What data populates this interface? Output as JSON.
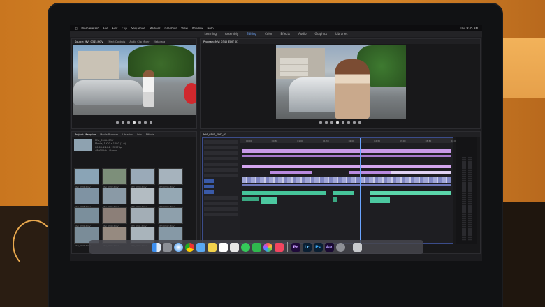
{
  "menubar": {
    "items": [
      "Premiere Pro",
      "File",
      "Edit",
      "Clip",
      "Sequence",
      "Markers",
      "Graphics",
      "View",
      "Window",
      "Help"
    ],
    "status": "Thu 9:45 AM"
  },
  "workspace": {
    "tabs": [
      "Learning",
      "Assembly",
      "Editing",
      "Color",
      "Effects",
      "Audio",
      "Graphics",
      "Libraries",
      "Editing"
    ],
    "active_index": 2
  },
  "source": {
    "tabs": [
      "Source: MVI_0345.MOV",
      "Effect Controls",
      "Audio Clip Mixer",
      "Metadata"
    ]
  },
  "program": {
    "tabs": [
      "Program: MVI_0345_EDIT_01"
    ]
  },
  "project": {
    "tabs": [
      "Project: Marquise",
      "Media Browser",
      "Libraries",
      "Info",
      "Effects",
      "Markers",
      "History"
    ],
    "clip_name": "MVI_0345.MOV",
    "clip_meta": [
      "Movie, 1920 x 1080 (1.0)",
      "00:00:12:04, 23.976p",
      "48000 Hz - Stereo"
    ],
    "clips": [
      "MVI_0331.MOV",
      "MVI_0332.MOV",
      "MVI_0333.MOV",
      "MVI_0334.MOV",
      "MVI_0335.MOV",
      "MVI_0336.MOV",
      "MVI_0337.MOV",
      "MVI_0338.MOV",
      "MVI_0339.MOV",
      "MVI_0340.MOV",
      "MVI_0341.MOV",
      "MVI_0342.MOV",
      "MVI_0343.MOV",
      "MVI_0344.MOV",
      "MVI_0345.MOV",
      "MVI_0346.MOV"
    ]
  },
  "timeline": {
    "tab": "MVI_0345_EDIT_01",
    "timecodes": [
      "00:00",
      "00:30",
      "01:00",
      "01:30",
      "02:00",
      "02:30",
      "03:00",
      "03:30",
      "04:00",
      "04:30"
    ]
  },
  "colors": {
    "video_track": "#b98ae0",
    "clip_track": "#9fa5d6",
    "audio_track": "#46c49a",
    "playhead": "#6aa4ff"
  },
  "dock": {
    "icons": [
      "finder-icon",
      "launchpad-icon",
      "safari-icon",
      "chrome-icon",
      "mail-icon",
      "notes-icon",
      "calendar-icon",
      "files-icon",
      "messages-icon",
      "facetime-icon",
      "photos-icon",
      "music-icon",
      "premiere-icon",
      "lightroom-icon",
      "photoshop-icon",
      "aftereffects-icon",
      "preferences-icon",
      "trash-icon"
    ],
    "labels": [
      "",
      "",
      "",
      "",
      "",
      "",
      "",
      "",
      "",
      "",
      "",
      "",
      "Pr",
      "Lr",
      "Ps",
      "Ae",
      "",
      ""
    ]
  }
}
